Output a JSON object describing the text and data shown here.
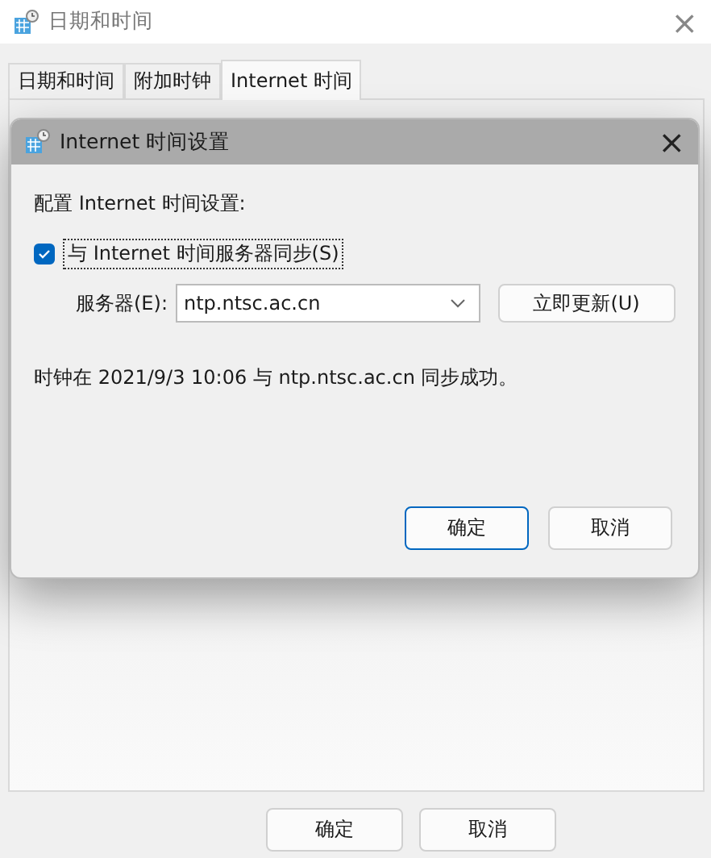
{
  "window": {
    "title": "日期和时间",
    "close": "×"
  },
  "tabs": [
    {
      "label": "日期和时间",
      "selected": false
    },
    {
      "label": "附加时钟",
      "selected": false
    },
    {
      "label": "Internet 时间",
      "selected": true
    }
  ],
  "dialog": {
    "title": "Internet 时间设置",
    "close": "×",
    "heading": "配置 Internet 时间设置:",
    "sync": {
      "label": "与 Internet 时间服务器同步(S)",
      "checked": true
    },
    "server": {
      "label": "服务器(E):",
      "value": "ntp.ntsc.ac.cn"
    },
    "update_button": "立即更新(U)",
    "status": "时钟在 2021/9/3 10:06 与 ntp.ntsc.ac.cn 同步成功。",
    "buttons": [
      {
        "label": "确定",
        "default": true
      },
      {
        "label": "取消",
        "default": false
      }
    ]
  },
  "buttons": [
    "确定",
    "取消"
  ]
}
